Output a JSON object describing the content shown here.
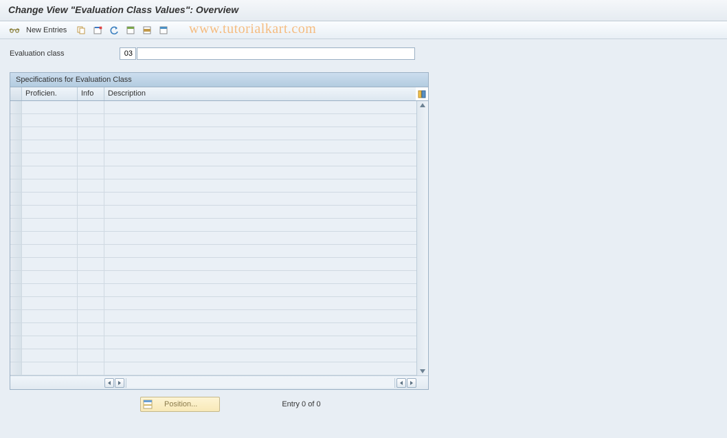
{
  "title": "Change View \"Evaluation Class Values\": Overview",
  "toolbar": {
    "new_entries": "New Entries",
    "icons": [
      "glasses-icon",
      "copy-icon",
      "delete-icon",
      "undo-icon",
      "select-all-icon",
      "select-block-icon",
      "deselect-all-icon"
    ]
  },
  "watermark": "www.tutorialkart.com",
  "field": {
    "label": "Evaluation class",
    "value": "03",
    "description": ""
  },
  "table": {
    "title": "Specifications for Evaluation Class",
    "columns": {
      "proficiency": "Proficien.",
      "info": "Info",
      "description": "Description"
    },
    "rows": [
      {
        "p": "",
        "i": "",
        "d": ""
      },
      {
        "p": "",
        "i": "",
        "d": ""
      },
      {
        "p": "",
        "i": "",
        "d": ""
      },
      {
        "p": "",
        "i": "",
        "d": ""
      },
      {
        "p": "",
        "i": "",
        "d": ""
      },
      {
        "p": "",
        "i": "",
        "d": ""
      },
      {
        "p": "",
        "i": "",
        "d": ""
      },
      {
        "p": "",
        "i": "",
        "d": ""
      },
      {
        "p": "",
        "i": "",
        "d": ""
      },
      {
        "p": "",
        "i": "",
        "d": ""
      },
      {
        "p": "",
        "i": "",
        "d": ""
      },
      {
        "p": "",
        "i": "",
        "d": ""
      },
      {
        "p": "",
        "i": "",
        "d": ""
      },
      {
        "p": "",
        "i": "",
        "d": ""
      },
      {
        "p": "",
        "i": "",
        "d": ""
      },
      {
        "p": "",
        "i": "",
        "d": ""
      },
      {
        "p": "",
        "i": "",
        "d": ""
      },
      {
        "p": "",
        "i": "",
        "d": ""
      },
      {
        "p": "",
        "i": "",
        "d": ""
      },
      {
        "p": "",
        "i": "",
        "d": ""
      },
      {
        "p": "",
        "i": "",
        "d": ""
      }
    ]
  },
  "position_button": "Position...",
  "entry_status": "Entry 0 of 0"
}
